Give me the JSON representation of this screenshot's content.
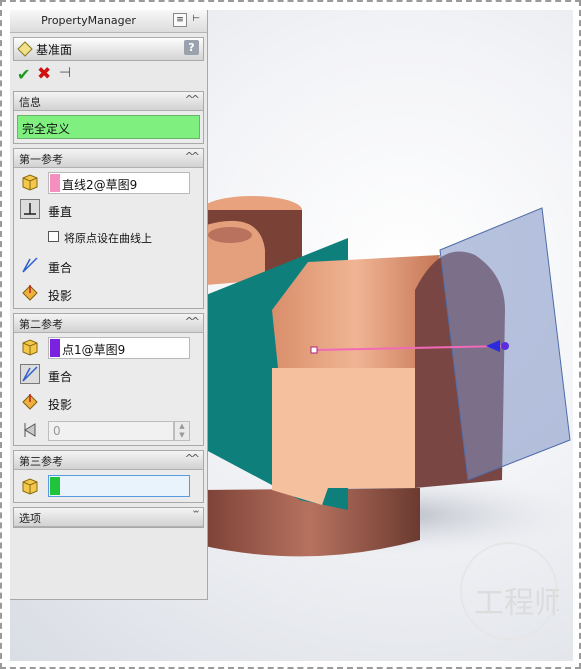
{
  "panel": {
    "title": "PropertyManager",
    "feature_title": "基准面",
    "help": "?",
    "info": {
      "header": "信息",
      "status": "完全定义"
    },
    "ref1": {
      "header": "第一参考",
      "selection": "直线2@草图9",
      "swatch": "#f48fbf",
      "opt_perpendicular": "垂直",
      "checkbox_label": "将原点设在曲线上",
      "opt_coincident": "重合",
      "opt_projection": "投影"
    },
    "ref2": {
      "header": "第二参考",
      "selection": "点1@草图9",
      "swatch": "#7a22e0",
      "opt_coincident": "重合",
      "opt_projection": "投影",
      "angle_value": "0"
    },
    "ref3": {
      "header": "第三参考",
      "selection": "",
      "swatch": "#1fc43a"
    },
    "options": {
      "header": "选项"
    }
  },
  "watermark": {
    "text": "工程师"
  },
  "colors": {
    "status_green": "#7ff07f",
    "copper": "#e2a07c",
    "teal": "#0f7f7c",
    "plane": "#7e92c4"
  }
}
